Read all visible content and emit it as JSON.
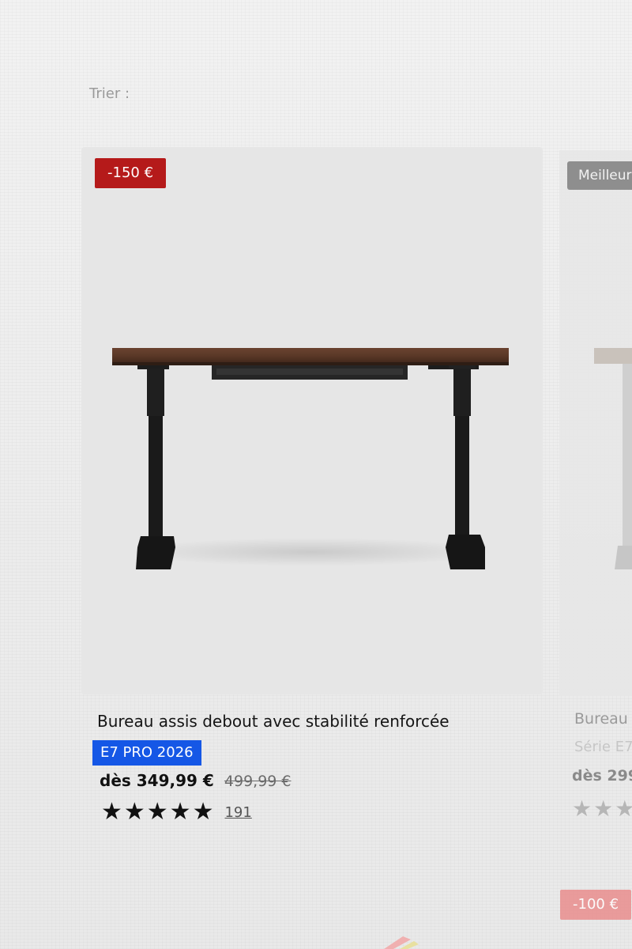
{
  "toolbar": {
    "sort_label": "Trier :"
  },
  "product": {
    "discount_badge": "-150 €",
    "title": "Bureau assis debout avec stabilité renforcée",
    "model": "E7 PRO 2026",
    "price_current": "dès 349,99 €",
    "price_old": "499,99 €",
    "rating": 5,
    "stars": "★★★★★",
    "review_count": "191"
  },
  "next_product": {
    "badge": "Meilleur",
    "title": "Bureau",
    "series": "Série E7",
    "price": "dès 299",
    "stars": "★★★",
    "next_badge": "-100 €"
  },
  "colors": {
    "discount_red": "#b51a1a",
    "model_blue": "#1557e6",
    "bestseller_gray": "#8e8e8e"
  }
}
